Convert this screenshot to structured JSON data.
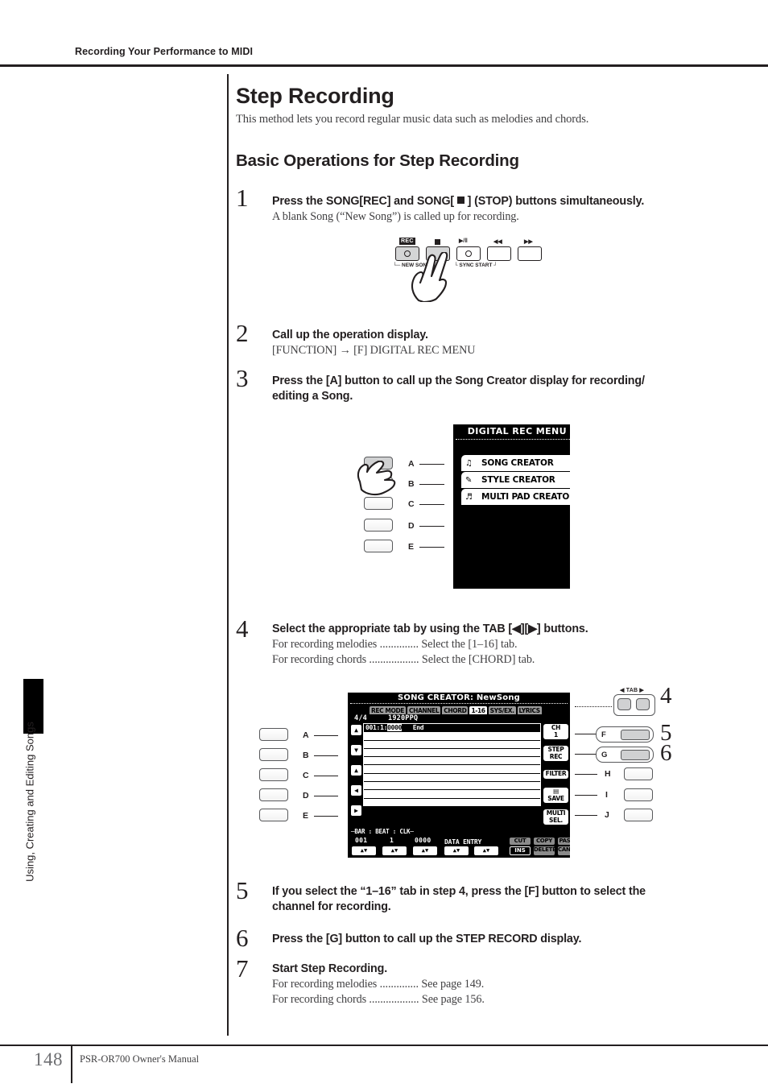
{
  "running_head": "Recording Your Performance to MIDI",
  "side_tab_label": "Using, Creating and Editing Songs",
  "footer": {
    "page_number": "148",
    "manual": "PSR-OR700 Owner's Manual"
  },
  "headings": {
    "h1": "Step Recording",
    "h1_sub": "This method lets you record regular music data such as melodies and chords.",
    "h2": "Basic Operations for Step Recording"
  },
  "steps": [
    {
      "num": "1",
      "lead_a": "Press the SONG[REC] and SONG[ ",
      "lead_b": " ] (STOP) buttons simultaneously.",
      "body": "A blank Song (“New Song”) is called up for recording."
    },
    {
      "num": "2",
      "lead": "Call up the operation display.",
      "body": "[FUNCTION] → [F] DIGITAL REC MENU"
    },
    {
      "num": "3",
      "lead_line1": "Press the [A] button to call up the Song Creator display for recording/",
      "lead_line2": "editing a Song."
    },
    {
      "num": "4",
      "lead": "Select the appropriate tab by using the TAB [◀][▶] buttons.",
      "row1": "For recording melodies .............. Select the [1–16] tab.",
      "row2": "For recording chords .................. Select the [CHORD] tab."
    },
    {
      "num": "5",
      "lead_line1": "If you select the “1–16” tab in step 4, press the [F] button to select the",
      "lead_line2": "channel for recording."
    },
    {
      "num": "6",
      "lead": "Press the [G] button to call up the STEP RECORD display."
    },
    {
      "num": "7",
      "lead": "Start Step Recording.",
      "row1": "For recording melodies .............. See page 149.",
      "row2": "For recording chords .................. See page 156."
    }
  ],
  "fig_transport": {
    "rec_label": "REC",
    "new_song_bracket": "└─ NEW SONG ─┘",
    "sync_start_bracket": "└ SYNC START ┘",
    "buttons": [
      {
        "name": "rec",
        "glyph": "○"
      },
      {
        "name": "stop",
        "glyph": ""
      },
      {
        "name": "play-pause",
        "glyph": "○"
      },
      {
        "name": "rewind",
        "glyph": ""
      },
      {
        "name": "fast-forward",
        "glyph": ""
      }
    ],
    "play_pause_label": "▶/‖",
    "rew_label": "◀◀",
    "ff_label": "▶▶"
  },
  "fig_digital_rec": {
    "panel_letters": [
      "A",
      "B",
      "C",
      "D",
      "E"
    ],
    "lcd_title": "DIGITAL REC MENU",
    "menu_items": [
      {
        "icon": "music-note-icon",
        "glyph": "♫",
        "label": "SONG CREATOR"
      },
      {
        "icon": "style-icon",
        "glyph": "✎",
        "label": "STYLE CREATOR"
      },
      {
        "icon": "multipad-icon",
        "glyph": "♬",
        "label": "MULTI PAD CREATOR"
      }
    ]
  },
  "fig_song_creator": {
    "left_letters": [
      "A",
      "B",
      "C",
      "D",
      "E"
    ],
    "right_letters": [
      "H",
      "I",
      "J"
    ],
    "tab_header": "TAB",
    "tab_left_glyph": "◀",
    "tab_right_glyph": "▶",
    "callouts": {
      "tab": "4",
      "f": "5",
      "g": "6"
    },
    "f_label": "F",
    "g_label": "G",
    "lcd": {
      "title": "SONG CREATOR: NewSong",
      "tabs": [
        {
          "label": "REC MODE",
          "active": false
        },
        {
          "label": "CHANNEL",
          "active": false
        },
        {
          "label": "CHORD",
          "active": false
        },
        {
          "label": "1-16",
          "active": true
        },
        {
          "label": "SYS/EX.",
          "active": false
        },
        {
          "label": "LYRICS",
          "active": false
        }
      ],
      "time_signature": "4/4",
      "resolution": "1920PPQ",
      "selected_row": {
        "position": "001:1:",
        "clock": "0000",
        "event": "End"
      },
      "side_buttons": [
        {
          "name": "channel-selector",
          "line1": "CH",
          "line2": "1"
        },
        {
          "name": "step-rec-button",
          "line1": "STEP",
          "line2": "REC"
        },
        {
          "name": "filter-button",
          "line1": "FILTER",
          "line2": ""
        },
        {
          "name": "save-button",
          "line1": "▤",
          "line2": "SAVE"
        },
        {
          "name": "multi-select-button",
          "line1": "MULTI",
          "line2": "SEL."
        }
      ],
      "bottom": {
        "header": "─BAR : BEAT : CLK─",
        "bar": "001",
        "beat": "1",
        "clk": "0000",
        "data_entry": "DATA ENTRY",
        "actions": [
          {
            "label_top": "CUT",
            "label_bottom": "INS",
            "state": "dark"
          },
          {
            "label_top": "COPY",
            "label_bottom": "DELETE",
            "state": "grey"
          },
          {
            "label_top": "PASTE",
            "label_bottom": "CANCEL",
            "state": "grey"
          }
        ]
      }
    }
  }
}
